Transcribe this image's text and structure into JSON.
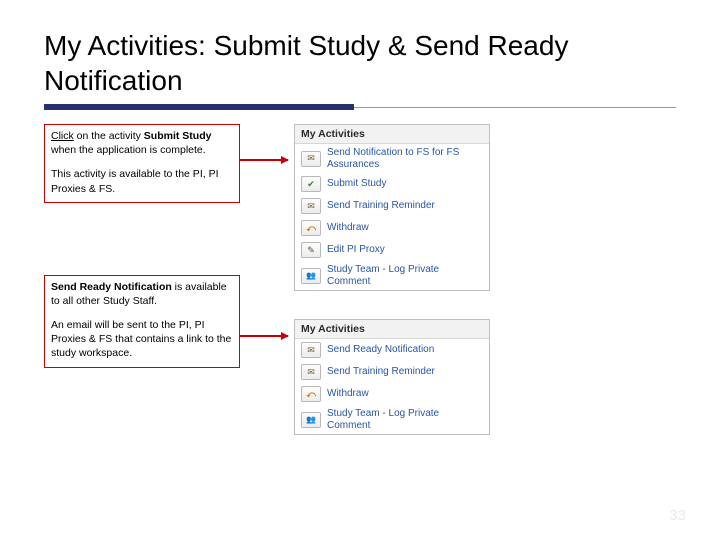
{
  "title": "My Activities: Submit Study & Send Ready Notification",
  "callouts": {
    "c1": {
      "p1_pre": "Click",
      "p1_mid": " on the activity ",
      "p1_bold": "Submit Study",
      "p1_post": " when the application is complete.",
      "p2": "This activity is available to the PI, PI Proxies & FS."
    },
    "c2": {
      "p1_bold": "Send Ready Notification",
      "p1_post": " is available to all other Study Staff.",
      "p2": "An email will be sent to the PI, PI Proxies & FS that contains a link to the study workspace."
    }
  },
  "panels": {
    "header": "My Activities",
    "top": [
      {
        "icon": "mail-icon",
        "glyph": "✉",
        "cls": "ic-mail",
        "label": "Send Notification to FS for FS Assurances"
      },
      {
        "icon": "check-icon",
        "glyph": "✔",
        "cls": "ic-check",
        "label": "Submit Study"
      },
      {
        "icon": "mail-icon",
        "glyph": "✉",
        "cls": "ic-mail",
        "label": "Send Training Reminder"
      },
      {
        "icon": "withdraw-icon",
        "glyph": "⤺",
        "cls": "ic-withdraw",
        "label": "Withdraw"
      },
      {
        "icon": "edit-icon",
        "glyph": "✎",
        "cls": "ic-edit",
        "label": "Edit PI Proxy"
      },
      {
        "icon": "team-icon",
        "glyph": "👥",
        "cls": "ic-team",
        "label": "Study Team - Log Private Comment"
      }
    ],
    "bottom": [
      {
        "icon": "mail-icon",
        "glyph": "✉",
        "cls": "ic-mail",
        "label": "Send Ready Notification"
      },
      {
        "icon": "mail-icon",
        "glyph": "✉",
        "cls": "ic-mail",
        "label": "Send Training Reminder"
      },
      {
        "icon": "withdraw-icon",
        "glyph": "⤺",
        "cls": "ic-withdraw",
        "label": "Withdraw"
      },
      {
        "icon": "team-icon",
        "glyph": "👥",
        "cls": "ic-team",
        "label": "Study Team - Log Private Comment"
      }
    ]
  },
  "pageNumber": "33"
}
